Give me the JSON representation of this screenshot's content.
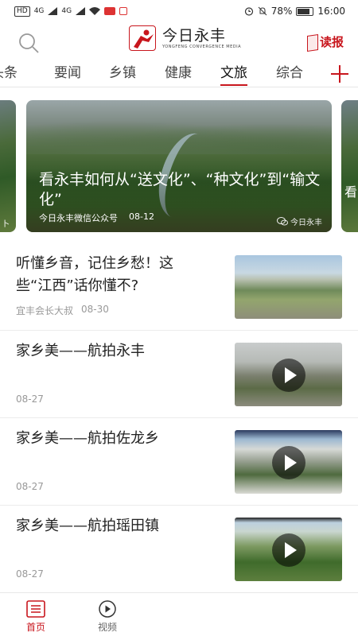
{
  "status_bar": {
    "left_chip": "HD",
    "signal_1": "4G",
    "signal_2": "4G",
    "battery_pct": "78%",
    "time": "16:00"
  },
  "header": {
    "logo_cn": "今日永丰",
    "logo_en": "YONGFENG CONVERGENCE MEDIA",
    "dubao_label": "读报"
  },
  "tabs": [
    {
      "label": "头条",
      "active": false
    },
    {
      "label": "要闻",
      "active": false
    },
    {
      "label": "乡镇",
      "active": false
    },
    {
      "label": "健康",
      "active": false
    },
    {
      "label": "文旅",
      "active": true
    },
    {
      "label": "综合",
      "active": false
    }
  ],
  "carousel": {
    "main": {
      "title": "看永丰如何从“送文化”、“种文化”到“输文化”",
      "source": "今日永丰微信公众号",
      "date": "08-12",
      "watermark": "今日永丰"
    },
    "left_peek_label": "卜",
    "right_peek_label": "看"
  },
  "news": [
    {
      "title": "听懂乡音，记住乡愁！这些“江西”话你懂不?",
      "source": "宜丰会长大叔",
      "date": "08-30",
      "video": false
    },
    {
      "title": "家乡美——航拍永丰",
      "source": "",
      "date": "08-27",
      "video": true
    },
    {
      "title": "家乡美——航拍佐龙乡",
      "source": "",
      "date": "08-27",
      "video": true
    },
    {
      "title": "家乡美——航拍瑶田镇",
      "source": "",
      "date": "08-27",
      "video": true
    }
  ],
  "bottom_nav": [
    {
      "label": "首页",
      "active": true
    },
    {
      "label": "视频",
      "active": false
    }
  ],
  "colors": {
    "accent": "#c8161d",
    "text": "#222222",
    "meta": "#999999"
  }
}
